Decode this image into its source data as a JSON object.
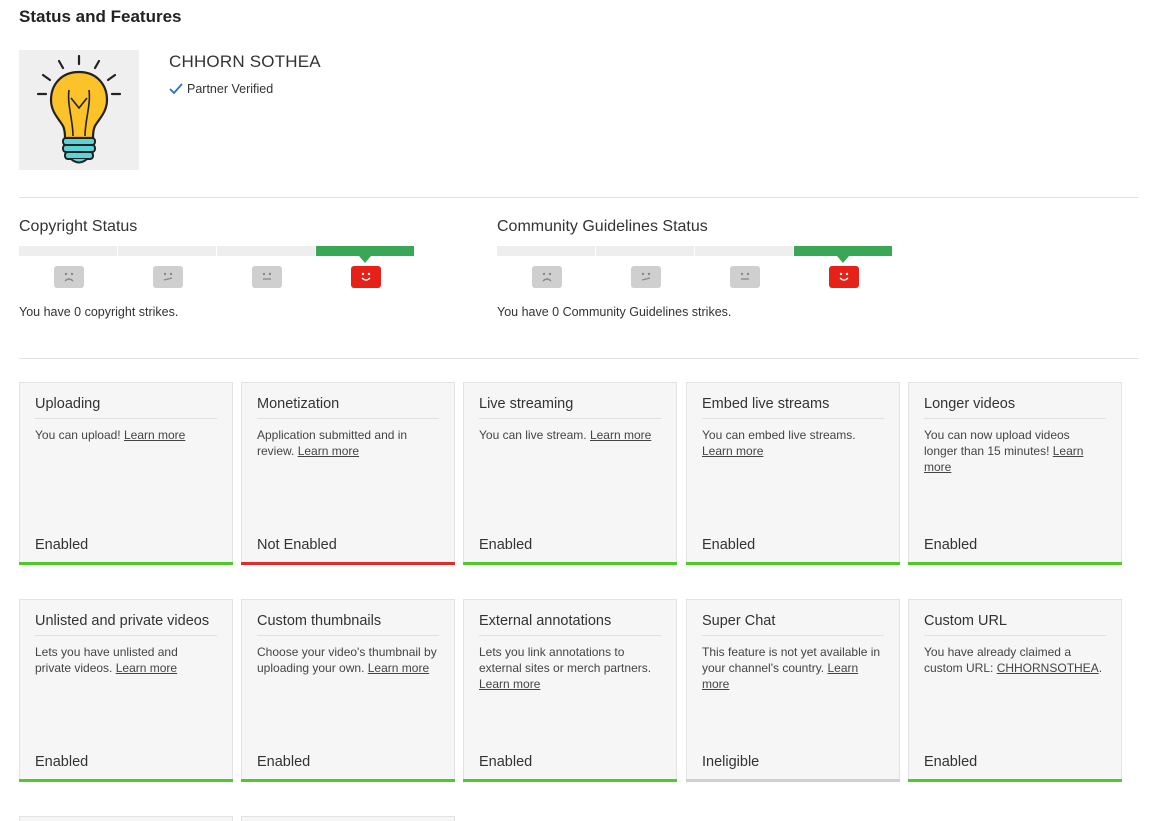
{
  "page": {
    "title": "Status and Features"
  },
  "channel": {
    "name": "CHHORN SOTHEA",
    "badge": "Partner Verified",
    "avatar_icon": "lightbulb-icon"
  },
  "copyright": {
    "title": "Copyright Status",
    "text": "You have 0 copyright strikes.",
    "active_segment": 4
  },
  "community": {
    "title": "Community Guidelines Status",
    "text": "You have 0 Community Guidelines strikes.",
    "active_segment": 4
  },
  "colors": {
    "enabled": "#4ccb28",
    "not_enabled": "#e52a2a",
    "ineligible": "#cfcfcf",
    "strike_active": "#3aa757",
    "happy_face": "#e62117"
  },
  "cards": [
    {
      "title": "Uploading",
      "desc": "You can upload! ",
      "link": "Learn more",
      "desc_after": "",
      "status": "Enabled",
      "state": "enabled"
    },
    {
      "title": "Monetization",
      "desc": "Application submitted and in review. ",
      "link": "Learn more",
      "desc_after": "",
      "status": "Not Enabled",
      "state": "not-enabled"
    },
    {
      "title": "Live streaming",
      "desc": "You can live stream. ",
      "link": "Learn more",
      "desc_after": "",
      "status": "Enabled",
      "state": "enabled"
    },
    {
      "title": "Embed live streams",
      "desc": "You can embed live streams. ",
      "link": "Learn more",
      "desc_after": "",
      "status": "Enabled",
      "state": "enabled"
    },
    {
      "title": "Longer videos",
      "desc": "You can now upload videos longer than 15 minutes! ",
      "link": "Learn more",
      "desc_after": "",
      "status": "Enabled",
      "state": "enabled"
    },
    {
      "title": "Unlisted and private videos",
      "desc": "Lets you have unlisted and private videos. ",
      "link": "Learn more",
      "desc_after": "",
      "status": "Enabled",
      "state": "enabled"
    },
    {
      "title": "Custom thumbnails",
      "desc": "Choose your video's thumbnail by uploading your own. ",
      "link": "Learn more",
      "desc_after": "",
      "status": "Enabled",
      "state": "enabled"
    },
    {
      "title": "External annotations",
      "desc": "Lets you link annotations to external sites or merch partners. ",
      "link": "Learn more",
      "desc_after": "",
      "status": "Enabled",
      "state": "enabled"
    },
    {
      "title": "Super Chat",
      "desc": "This feature is not yet available in your channel's country. ",
      "link": "Learn more",
      "desc_after": "",
      "status": "Ineligible",
      "state": "ineligible"
    },
    {
      "title": "Custom URL",
      "desc": "You have already claimed a custom URL: ",
      "link": "CHHORNSOTHEA",
      "desc_after": ".",
      "status": "Enabled",
      "state": "enabled"
    }
  ]
}
